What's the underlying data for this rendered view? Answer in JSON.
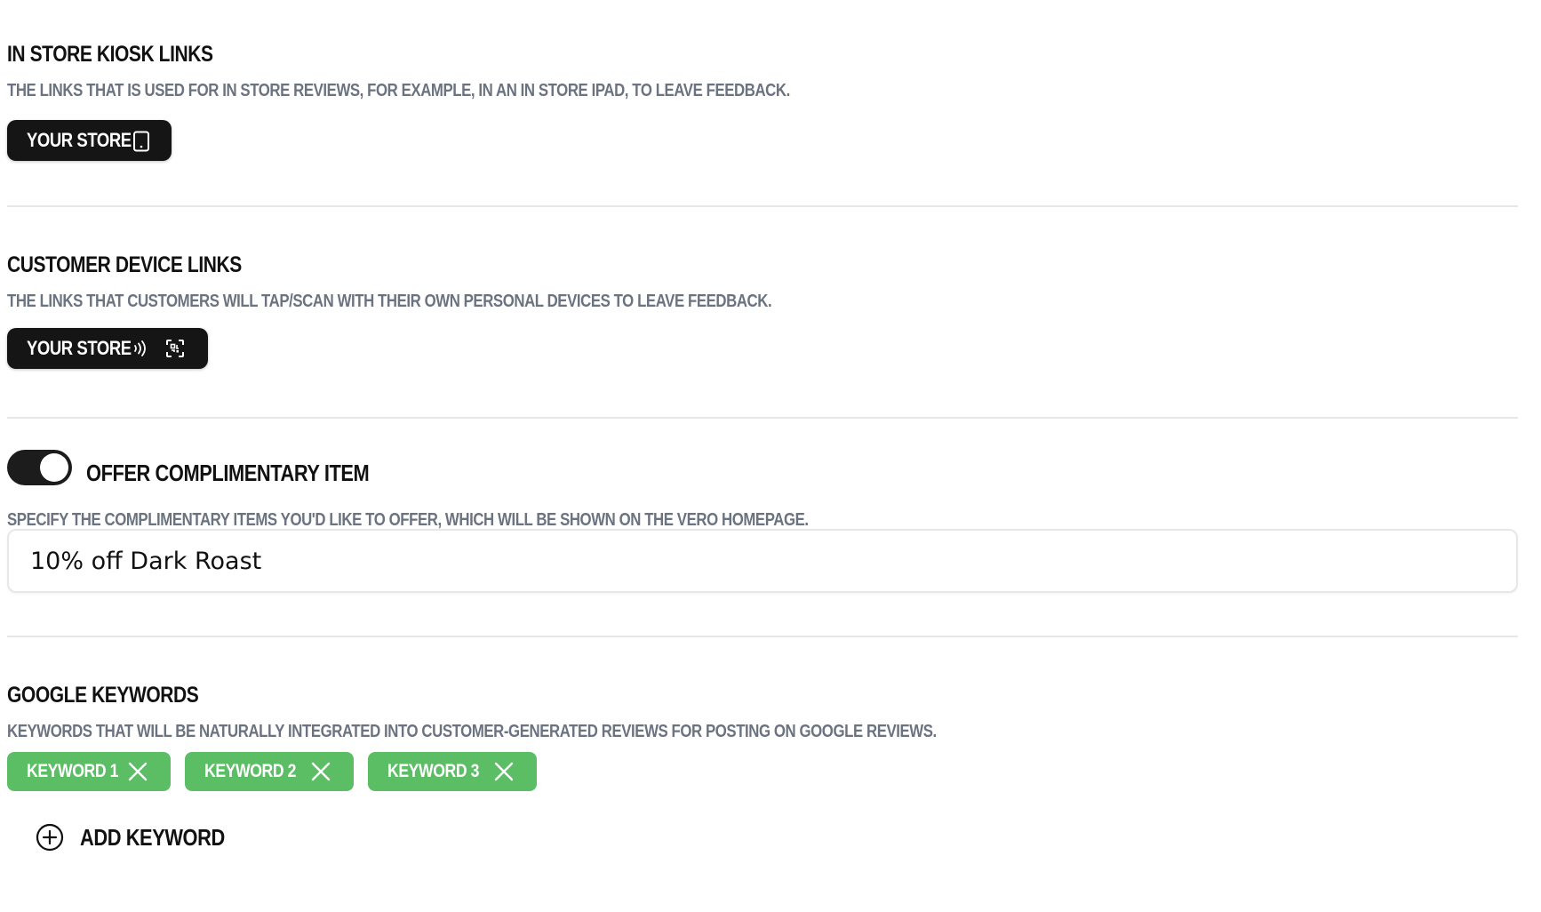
{
  "kiosk": {
    "title": "IN STORE KIOSK LINKS",
    "description": "THE LINKS THAT IS USED FOR IN STORE REVIEWS, FOR EXAMPLE, IN AN IN STORE IPAD, TO LEAVE FEEDBACK.",
    "button_label": "YOUR STORE",
    "icon": "tablet-icon"
  },
  "customer_device": {
    "title": "CUSTOMER DEVICE LINKS",
    "description": "THE LINKS THAT CUSTOMERS WILL TAP/SCAN WITH THEIR OWN PERSONAL DEVICES TO LEAVE FEEDBACK.",
    "button_label": "YOUR STORE",
    "icons": [
      "nfc-icon",
      "qr-scan-icon"
    ]
  },
  "complimentary": {
    "toggle_on": true,
    "title": "OFFER COMPLIMENTARY ITEM",
    "description": "SPECIFY THE COMPLIMENTARY ITEMS YOU'D LIKE TO OFFER, WHICH WILL BE SHOWN ON THE VERO HOMEPAGE.",
    "input_value": "10% off Dark Roast"
  },
  "keywords": {
    "title": "GOOGLE KEYWORDS",
    "description": "KEYWORDS THAT WILL BE NATURALLY INTEGRATED INTO CUSTOMER-GENERATED REVIEWS FOR POSTING ON GOOGLE REVIEWS.",
    "items": [
      "KEYWORD 1",
      "KEYWORD 2",
      "KEYWORD 3"
    ],
    "add_label": "ADD KEYWORD"
  },
  "colors": {
    "dark_button": "#151515",
    "chip_green": "#5cbe64",
    "muted_text": "#6b7280",
    "divider": "#e5e7eb"
  }
}
